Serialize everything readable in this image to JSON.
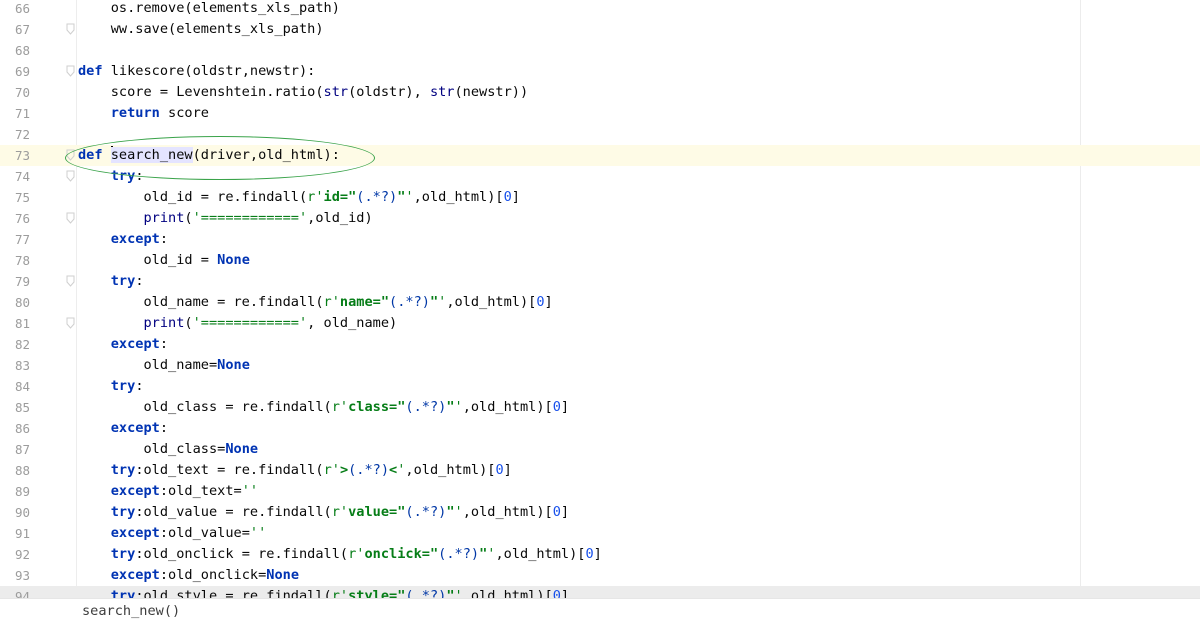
{
  "editor": {
    "lines": [
      {
        "n": "66",
        "fold": false,
        "tokens": [
          {
            "t": "    os.remove(elements_xls_path)",
            "c": ""
          }
        ]
      },
      {
        "n": "67",
        "fold": true,
        "tokens": [
          {
            "t": "    ww.save(elements_xls_path)",
            "c": ""
          }
        ]
      },
      {
        "n": "68",
        "fold": false,
        "tokens": []
      },
      {
        "n": "69",
        "fold": true,
        "tokens": [
          {
            "t": "def ",
            "c": "kw"
          },
          {
            "t": "likescore(oldstr,newstr):",
            "c": ""
          }
        ]
      },
      {
        "n": "70",
        "fold": false,
        "tokens": [
          {
            "t": "    score = Levenshtein.ratio(",
            "c": ""
          },
          {
            "t": "str",
            "c": "bi"
          },
          {
            "t": "(oldstr), ",
            "c": ""
          },
          {
            "t": "str",
            "c": "bi"
          },
          {
            "t": "(newstr))",
            "c": ""
          }
        ]
      },
      {
        "n": "71",
        "fold": false,
        "tokens": [
          {
            "t": "    ",
            "c": ""
          },
          {
            "t": "return",
            "c": "kw"
          },
          {
            "t": " score",
            "c": ""
          }
        ]
      },
      {
        "n": "72",
        "fold": false,
        "tokens": []
      },
      {
        "n": "73",
        "fold": true,
        "current": true,
        "tokens": [
          {
            "t": "def ",
            "c": "kw"
          },
          {
            "t": "CARET",
            "c": "caret"
          },
          {
            "t": "search_new",
            "c": "hl"
          },
          {
            "t": "(driver,old_html):",
            "c": ""
          }
        ]
      },
      {
        "n": "74",
        "fold": true,
        "tokens": [
          {
            "t": "    ",
            "c": ""
          },
          {
            "t": "try",
            "c": "kw"
          },
          {
            "t": ":",
            "c": ""
          }
        ]
      },
      {
        "n": "75",
        "fold": false,
        "tokens": [
          {
            "t": "        old_id = re.findall(",
            "c": ""
          },
          {
            "t": "r'",
            "c": "st"
          },
          {
            "t": "id=\"",
            "c": "st-b"
          },
          {
            "t": "(.*?)",
            "c": "esc"
          },
          {
            "t": "\"",
            "c": "st-b"
          },
          {
            "t": "'",
            "c": "st"
          },
          {
            "t": ",old_html)[",
            "c": ""
          },
          {
            "t": "0",
            "c": "num"
          },
          {
            "t": "]",
            "c": ""
          }
        ]
      },
      {
        "n": "76",
        "fold": true,
        "tokens": [
          {
            "t": "        ",
            "c": ""
          },
          {
            "t": "print",
            "c": "bi"
          },
          {
            "t": "(",
            "c": ""
          },
          {
            "t": "'============'",
            "c": "st"
          },
          {
            "t": ",old_id)",
            "c": ""
          }
        ]
      },
      {
        "n": "77",
        "fold": false,
        "tokens": [
          {
            "t": "    ",
            "c": ""
          },
          {
            "t": "except",
            "c": "kw"
          },
          {
            "t": ":",
            "c": ""
          }
        ]
      },
      {
        "n": "78",
        "fold": false,
        "tokens": [
          {
            "t": "        old_id = ",
            "c": ""
          },
          {
            "t": "None",
            "c": "kw"
          }
        ]
      },
      {
        "n": "79",
        "fold": true,
        "tokens": [
          {
            "t": "    ",
            "c": ""
          },
          {
            "t": "try",
            "c": "kw"
          },
          {
            "t": ":",
            "c": ""
          }
        ]
      },
      {
        "n": "80",
        "fold": false,
        "tokens": [
          {
            "t": "        old_name = re.findall(",
            "c": ""
          },
          {
            "t": "r'",
            "c": "st"
          },
          {
            "t": "name=\"",
            "c": "st-b"
          },
          {
            "t": "(.*?)",
            "c": "esc"
          },
          {
            "t": "\"",
            "c": "st-b"
          },
          {
            "t": "'",
            "c": "st"
          },
          {
            "t": ",old_html)[",
            "c": ""
          },
          {
            "t": "0",
            "c": "num"
          },
          {
            "t": "]",
            "c": ""
          }
        ]
      },
      {
        "n": "81",
        "fold": true,
        "tokens": [
          {
            "t": "        ",
            "c": ""
          },
          {
            "t": "print",
            "c": "bi"
          },
          {
            "t": "(",
            "c": ""
          },
          {
            "t": "'============'",
            "c": "st"
          },
          {
            "t": ", old_name)",
            "c": ""
          }
        ]
      },
      {
        "n": "82",
        "fold": false,
        "tokens": [
          {
            "t": "    ",
            "c": ""
          },
          {
            "t": "except",
            "c": "kw"
          },
          {
            "t": ":",
            "c": ""
          }
        ]
      },
      {
        "n": "83",
        "fold": false,
        "tokens": [
          {
            "t": "        old_name=",
            "c": ""
          },
          {
            "t": "None",
            "c": "kw"
          }
        ]
      },
      {
        "n": "84",
        "fold": false,
        "tokens": [
          {
            "t": "    ",
            "c": ""
          },
          {
            "t": "try",
            "c": "kw"
          },
          {
            "t": ":",
            "c": ""
          }
        ]
      },
      {
        "n": "85",
        "fold": false,
        "tokens": [
          {
            "t": "        old_class = re.findall(",
            "c": ""
          },
          {
            "t": "r'",
            "c": "st"
          },
          {
            "t": "class=\"",
            "c": "st-b"
          },
          {
            "t": "(.*?)",
            "c": "esc"
          },
          {
            "t": "\"",
            "c": "st-b"
          },
          {
            "t": "'",
            "c": "st"
          },
          {
            "t": ",old_html)[",
            "c": ""
          },
          {
            "t": "0",
            "c": "num"
          },
          {
            "t": "]",
            "c": ""
          }
        ]
      },
      {
        "n": "86",
        "fold": false,
        "tokens": [
          {
            "t": "    ",
            "c": ""
          },
          {
            "t": "except",
            "c": "kw"
          },
          {
            "t": ":",
            "c": ""
          }
        ]
      },
      {
        "n": "87",
        "fold": false,
        "tokens": [
          {
            "t": "        old_class=",
            "c": ""
          },
          {
            "t": "None",
            "c": "kw"
          }
        ]
      },
      {
        "n": "88",
        "fold": false,
        "tokens": [
          {
            "t": "    ",
            "c": ""
          },
          {
            "t": "try",
            "c": "kw"
          },
          {
            "t": ":old_text = re.findall(",
            "c": ""
          },
          {
            "t": "r'",
            "c": "st"
          },
          {
            "t": ">",
            "c": "st-b"
          },
          {
            "t": "(.*?)",
            "c": "esc"
          },
          {
            "t": "<",
            "c": "st-b"
          },
          {
            "t": "'",
            "c": "st"
          },
          {
            "t": ",old_html)[",
            "c": ""
          },
          {
            "t": "0",
            "c": "num"
          },
          {
            "t": "]",
            "c": ""
          }
        ]
      },
      {
        "n": "89",
        "fold": false,
        "tokens": [
          {
            "t": "    ",
            "c": ""
          },
          {
            "t": "except",
            "c": "kw"
          },
          {
            "t": ":old_text=",
            "c": ""
          },
          {
            "t": "''",
            "c": "st"
          }
        ]
      },
      {
        "n": "90",
        "fold": false,
        "tokens": [
          {
            "t": "    ",
            "c": ""
          },
          {
            "t": "try",
            "c": "kw"
          },
          {
            "t": ":old_value = re.findall(",
            "c": ""
          },
          {
            "t": "r'",
            "c": "st"
          },
          {
            "t": "value=\"",
            "c": "st-b"
          },
          {
            "t": "(.*?)",
            "c": "esc"
          },
          {
            "t": "\"",
            "c": "st-b"
          },
          {
            "t": "'",
            "c": "st"
          },
          {
            "t": ",old_html)[",
            "c": ""
          },
          {
            "t": "0",
            "c": "num"
          },
          {
            "t": "]",
            "c": ""
          }
        ]
      },
      {
        "n": "91",
        "fold": false,
        "tokens": [
          {
            "t": "    ",
            "c": ""
          },
          {
            "t": "except",
            "c": "kw"
          },
          {
            "t": ":old_value=",
            "c": ""
          },
          {
            "t": "''",
            "c": "st"
          }
        ]
      },
      {
        "n": "92",
        "fold": false,
        "tokens": [
          {
            "t": "    ",
            "c": ""
          },
          {
            "t": "try",
            "c": "kw"
          },
          {
            "t": ":old_onclick = re.findall(",
            "c": ""
          },
          {
            "t": "r'",
            "c": "st"
          },
          {
            "t": "onclick=\"",
            "c": "st-b"
          },
          {
            "t": "(.*?)",
            "c": "esc"
          },
          {
            "t": "\"",
            "c": "st-b"
          },
          {
            "t": "'",
            "c": "st"
          },
          {
            "t": ",old_html)[",
            "c": ""
          },
          {
            "t": "0",
            "c": "num"
          },
          {
            "t": "]",
            "c": ""
          }
        ]
      },
      {
        "n": "93",
        "fold": false,
        "tokens": [
          {
            "t": "    ",
            "c": ""
          },
          {
            "t": "except",
            "c": "kw"
          },
          {
            "t": ":old_onclick=",
            "c": ""
          },
          {
            "t": "None",
            "c": "kw"
          }
        ]
      },
      {
        "n": "94",
        "fold": false,
        "highlight": true,
        "tokens": [
          {
            "t": "    ",
            "c": ""
          },
          {
            "t": "try",
            "c": "kw"
          },
          {
            "t": ":old_style = re.findall(",
            "c": ""
          },
          {
            "t": "r'",
            "c": "st"
          },
          {
            "t": "style=\"",
            "c": "st-b"
          },
          {
            "t": "(.*?)",
            "c": "esc"
          },
          {
            "t": "\"",
            "c": "st-b"
          },
          {
            "t": "'",
            "c": "st"
          },
          {
            "t": ",old_html)[",
            "c": ""
          },
          {
            "t": "0",
            "c": "num"
          },
          {
            "t": "]",
            "c": ""
          }
        ]
      }
    ]
  },
  "breadcrumb": {
    "text": "search_new()"
  },
  "colors": {
    "keyword": "#0033b3",
    "string": "#067d17",
    "number": "#1750eb",
    "current_line": "#fefbe6",
    "annotation": "#3aa34a"
  },
  "icons": {
    "fold": "fold-marker-icon"
  }
}
